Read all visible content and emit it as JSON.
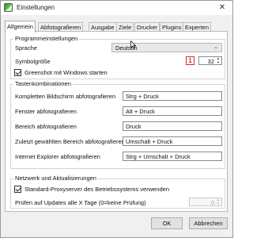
{
  "window": {
    "title": "Einstellungen",
    "close_glyph": "✕"
  },
  "tabs": [
    {
      "label": "Allgemein",
      "active": true
    },
    {
      "label": "Abfotografieren"
    },
    {
      "label": "Ausgabe"
    },
    {
      "label": "Ziele"
    },
    {
      "label": "Drucker"
    },
    {
      "label": "Plugins"
    },
    {
      "label": "Experten"
    }
  ],
  "program_settings": {
    "title": "Programmeinstellungen",
    "language_label": "Sprache",
    "language_value": "Deutsch",
    "icon_size_label": "Symbolgröße",
    "badge": "1",
    "icon_size_value": "32",
    "autostart_label": "Greenshot mit Windows starten",
    "autostart_checked": true
  },
  "hotkeys": {
    "title": "Tastenkombinationen",
    "rows": [
      {
        "label": "Kompletten Bildschirm abfotografieren",
        "value": "Strg + Druck"
      },
      {
        "label": "Fenster abfotografieren",
        "value": "Alt + Druck"
      },
      {
        "label": "Bereich abfotografieren",
        "value": "Druck"
      },
      {
        "label": "Zuletzt gewählten Bereich abfotografieren",
        "value": "Umschalt + Druck"
      },
      {
        "label": "Internet Explorer abfotografieren",
        "value": "Strg + Umschalt + Druck"
      }
    ]
  },
  "network": {
    "title": "Netzwerk und Aktualisierungen",
    "proxy_label": "Standard-Proxyserver des Betriebssystems verwenden",
    "proxy_checked": true,
    "update_label": "Prüfen auf Updates alle X Tage (0=keine Prüfung)",
    "update_value": "0"
  },
  "buttons": {
    "ok": "OK",
    "cancel": "Abbrechen"
  },
  "colors": {
    "badge": "#d0302e",
    "window_bg": "#f0f0f0",
    "panel_bg": "#ffffff"
  }
}
